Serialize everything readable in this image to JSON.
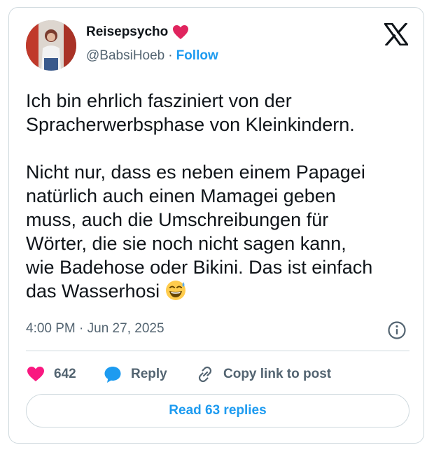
{
  "author": {
    "display_name": "Reisepsycho",
    "handle": "@BabsiHoeb",
    "separator": "·",
    "follow_label": "Follow"
  },
  "post": {
    "text": "Ich bin ehrlich fasziniert von der\nSpracherwerbsphase von Kleinkindern.\n\nNicht nur, dass es neben einem Papagei\nnatürlich auch einen Mamagei geben\nmuss, auch die Umschreibungen für\nWörter, die sie noch nicht sagen kann,\nwie Badehose oder Bikini. Das ist einfach\ndas Wasserhosi",
    "timestamp": "4:00 PM · Jun 27, 2025"
  },
  "actions": {
    "like_count": "642",
    "reply_label": "Reply",
    "copy_label": "Copy link to post"
  },
  "read_replies_label": "Read 63 replies",
  "colors": {
    "accent": "#1d9bf0",
    "like": "#f91880",
    "muted": "#536471",
    "border": "#cfd9de",
    "heart_badge": "#e0245e"
  },
  "icons": {
    "badge": "red-heart-icon",
    "logo": "x-logo-icon",
    "emoji": "grinning-sweat-emoji-icon",
    "info": "info-icon",
    "like": "heart-icon",
    "reply": "speech-bubble-icon",
    "copy": "link-icon"
  }
}
